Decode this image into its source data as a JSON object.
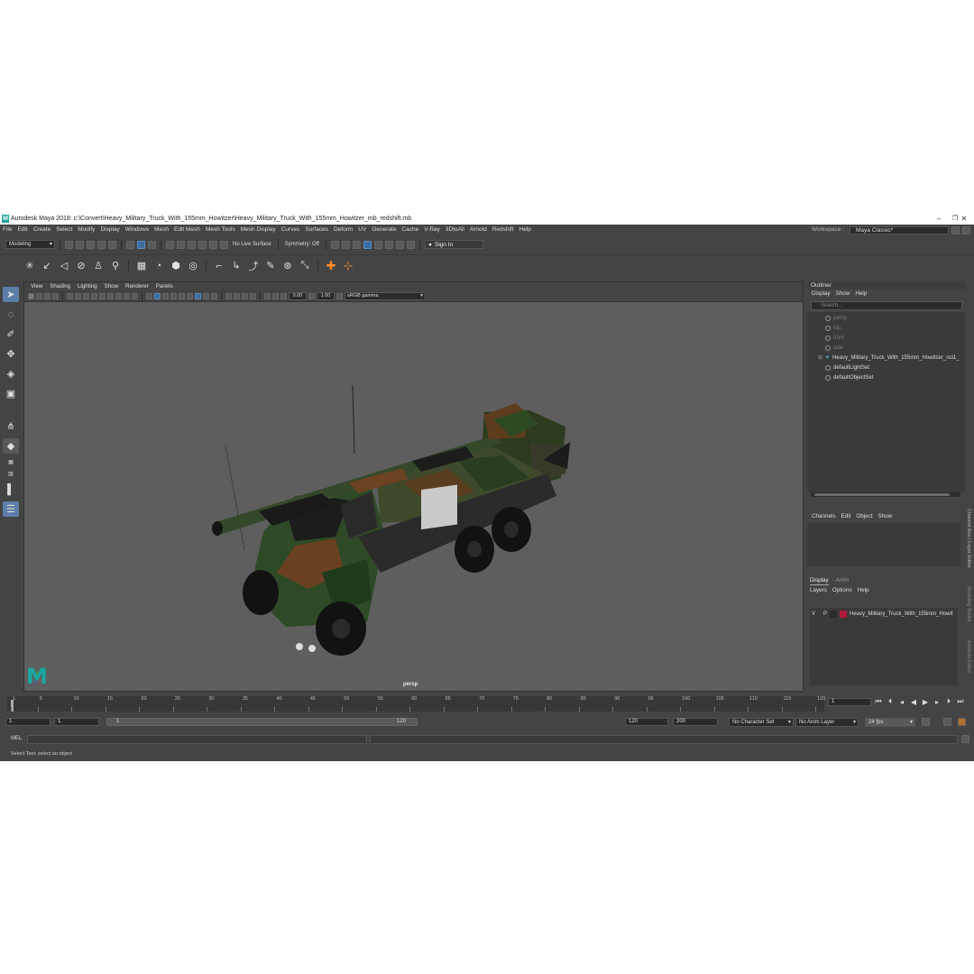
{
  "window": {
    "title": "Autodesk Maya 2018: c:\\Convert\\Heavy_Military_Truck_With_155mm_Howitzer\\Heavy_Military_Truck_With_155mm_Howitzer_mb_redshift.mb",
    "logo_letter": "M"
  },
  "menubar": {
    "items": [
      "File",
      "Edit",
      "Create",
      "Select",
      "Modify",
      "Display",
      "Windows",
      "Mesh",
      "Edit Mesh",
      "Mesh Tools",
      "Mesh Display",
      "Curves",
      "Surfaces",
      "Deform",
      "UV",
      "Generate",
      "Cache",
      "V-Ray",
      "3DtoAll",
      "Arnold",
      "Redshift",
      "Help"
    ],
    "workspace_label": "Workspace :",
    "workspace_value": "Maya Classic*"
  },
  "statusline": {
    "mode": "Modeling",
    "live_surface": "No Live Surface",
    "symmetry": "Symmetry: Off",
    "sign_in": "Sign In"
  },
  "viewport": {
    "menu": [
      "View",
      "Shading",
      "Lighting",
      "Show",
      "Renderer",
      "Panels"
    ],
    "exposure": "0.00",
    "gamma": "1.00",
    "color_space": "sRGB gamma",
    "camera_label": "persp"
  },
  "outliner": {
    "title": "Outliner",
    "menu": [
      "Display",
      "Show",
      "Help"
    ],
    "search_placeholder": "Search...",
    "items": [
      {
        "label": "persp",
        "dim": true
      },
      {
        "label": "top",
        "dim": true
      },
      {
        "label": "front",
        "dim": true
      },
      {
        "label": "side",
        "dim": true
      },
      {
        "label": "Heavy_Military_Truck_With_155mm_Howitzer_ncl1_",
        "dim": false
      },
      {
        "label": "defaultLightSet",
        "dim": false
      },
      {
        "label": "defaultObjectSet",
        "dim": false
      }
    ]
  },
  "channelbox": {
    "menu": [
      "Channels",
      "Edit",
      "Object",
      "Show"
    ]
  },
  "layers": {
    "tabs": [
      "Display",
      "Anim"
    ],
    "menu": [
      "Layers",
      "Options",
      "Help"
    ],
    "row": {
      "v": "V",
      "p": "P",
      "name": "Heavy_Military_Truck_With_155mm_Howit"
    }
  },
  "side_tabs": [
    "Channel Box / Layer Editor",
    "Modeling Toolkit",
    "Attribute Editor"
  ],
  "timeline": {
    "ticks": [
      "1",
      "5",
      "10",
      "15",
      "20",
      "25",
      "30",
      "35",
      "40",
      "45",
      "50",
      "55",
      "60",
      "65",
      "70",
      "75",
      "80",
      "85",
      "90",
      "95",
      "100",
      "105",
      "110",
      "115",
      "120"
    ],
    "current_frame": "1"
  },
  "range": {
    "start": "1",
    "playback_start": "1",
    "slider_start": "1",
    "slider_end": "120",
    "playback_end": "120",
    "end": "200",
    "character_set": "No Character Set",
    "anim_layer": "No Anim Layer",
    "fps": "24 fps"
  },
  "command": {
    "label": "MEL"
  },
  "status": {
    "help": "Select Tool: select an object"
  }
}
